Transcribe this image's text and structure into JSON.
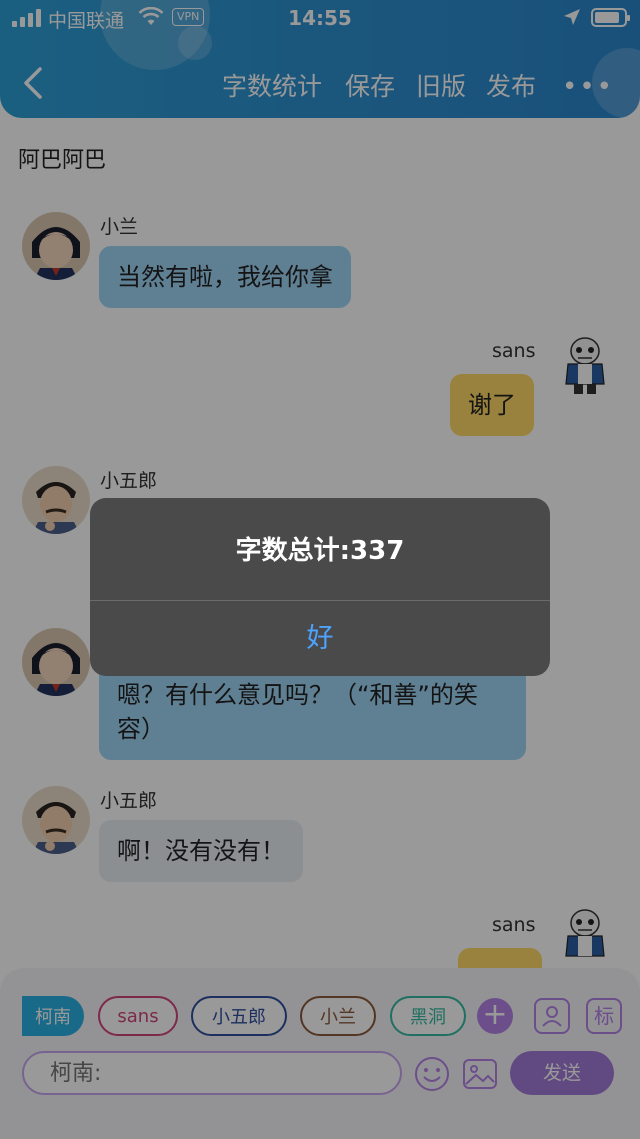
{
  "status_bar": {
    "carrier": "中国联通",
    "vpn": "VPN",
    "time": "14:55"
  },
  "header": {
    "nav": [
      {
        "label": "字数统计"
      },
      {
        "label": "保存"
      },
      {
        "label": "旧版"
      },
      {
        "label": "发布"
      }
    ],
    "more": "•••"
  },
  "chat": {
    "title": "阿巴阿巴",
    "messages": [
      {
        "sender": "小兰",
        "side": "left",
        "text": "当然有啦，我给你拿"
      },
      {
        "sender": "sans",
        "side": "right",
        "text": "谢了"
      },
      {
        "sender": "小五郎",
        "side": "left",
        "text": ""
      },
      {
        "sender": "",
        "side": "left",
        "text": "嗯？有什么意见吗？（“和善”的笑容）"
      },
      {
        "sender": "小五郎",
        "side": "left",
        "text": "啊！没有没有！"
      },
      {
        "sender": "sans",
        "side": "right",
        "text": ""
      }
    ]
  },
  "composer": {
    "characters": [
      {
        "label": "柯南",
        "color": "#2ab0e3",
        "active": true
      },
      {
        "label": "sans",
        "color": "#d0457a"
      },
      {
        "label": "小五郎",
        "color": "#2f4f9e"
      },
      {
        "label": "小兰",
        "color": "#8a5a3c"
      },
      {
        "label": "黑洞",
        "color": "#36b9a0"
      }
    ],
    "plus": "+",
    "tag_button": "标",
    "placeholder": "柯南:",
    "send": "发送"
  },
  "dialog": {
    "message": "字数总计:337",
    "ok": "好"
  },
  "colors": {
    "header": "#2d9fd6",
    "bubble_blue": "#9fd4f5",
    "bubble_yellow": "#ffd966",
    "accent_purple": "#a27ad8",
    "dialog_button": "#4da3ff"
  }
}
